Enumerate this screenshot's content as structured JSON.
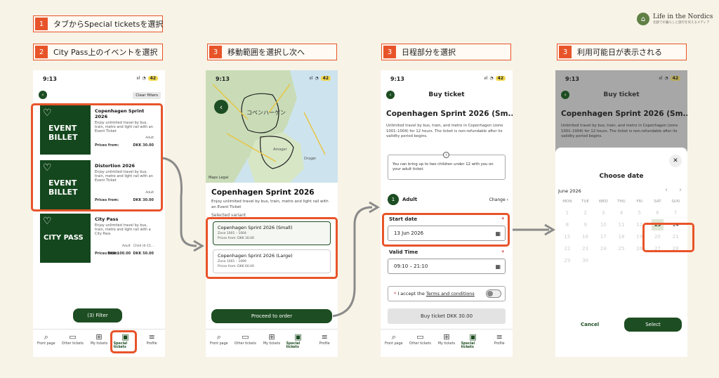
{
  "steps": [
    {
      "num": "1",
      "text": "タブからSpecial ticketsを選択"
    },
    {
      "num": "2",
      "text": "City Pass上のイベントを選択"
    },
    {
      "num": "3",
      "text": "移動範囲を選択し次へ"
    },
    {
      "num": "3",
      "text": "日程部分を選択"
    },
    {
      "num": "3",
      "text": "利用可能日が表示される"
    }
  ],
  "logo": {
    "title": "Life in the Nordics",
    "subtitle": "北欧での暮らしと旅行を伝えるメディア"
  },
  "status": {
    "time": "9:13",
    "signal": "ııl",
    "battery": "42"
  },
  "tabs": [
    "Front page",
    "Other tickets",
    "My tickets",
    "Special tickets",
    "Profile"
  ],
  "s1": {
    "clear": "Clear filters",
    "filter": "(3) Filter",
    "prices_from": "Prices from:",
    "adult": "Adult",
    "child": "Child (0-15...",
    "cards": [
      {
        "img": "EVENT\nBILLET",
        "title": "Copenhagen Sprint 2026",
        "desc": "Enjoy unlimited travel by bus, train, metro and light rail with an Event Ticket",
        "price": "DKK 30.00"
      },
      {
        "img": "EVENT\nBILLET",
        "title": "Distortion 2026",
        "desc": "Enjoy unlimited travel by bus, train, metro and light rail with an Event Ticket",
        "price": "DKK 30.00"
      },
      {
        "img": "CITY PASS",
        "title": "City Pass",
        "desc": "Enjoy unlimited travel by bus, train, metro and light rail with a City Pass",
        "price": "DKK 100.00",
        "price2": "DKK 50.00"
      }
    ]
  },
  "s2": {
    "map_city": "コペンハーゲン",
    "map_labels": [
      "Maps",
      "Legal",
      "Amager",
      "Dragør"
    ],
    "title": "Copenhagen Sprint 2026",
    "desc": "Enjoy unlimited travel by bus, train, metro and light rail with an Event Ticket",
    "selected_variant": "Selected variant",
    "variants": [
      {
        "title": "Copenhagen Sprint 2026 (Small)",
        "zone": "Zone 1001 – 1004",
        "price": "Prices from: DKK 30.00"
      },
      {
        "title": "Copenhagen Sprint 2026 (Large)",
        "zone": "Zone 1001 – 1099",
        "price": "Prices from: DKK 60.00"
      }
    ],
    "proceed": "Proceed to order"
  },
  "s3": {
    "header": "Buy ticket",
    "title": "Copenhagen Sprint 2026 (Sm...",
    "desc": "Unlimited travel by bus, train, and metro in Copenhagen (zone 1001–1004) for 12 hours. The ticket is non-refundable after its validity period begins.",
    "info": "You can bring up to two children under 12 with you on your adult ticket.",
    "adult_count": "1",
    "adult": "Adult",
    "change": "Change",
    "start_label": "Start date",
    "start_value": "13 Jun 2026",
    "valid_label": "Valid Time",
    "valid_value": "09:10 – 21:10",
    "accept_pre": "I accept the ",
    "terms": "Terms and conditions",
    "buy": "Buy ticket DKK 30.00"
  },
  "s4": {
    "header": "Buy ticket",
    "title": "Copenhagen Sprint 2026 (Sm...",
    "desc": "Unlimited travel by bus, train, and metro in Copenhagen (zone 1001–1004) for 12 hours. The ticket is non-refundable after its validity period begins.",
    "choose": "Choose date",
    "month": "June 2026",
    "weekdays": [
      "MON",
      "TUE",
      "WED",
      "THU",
      "FRI",
      "SAT",
      "SUN"
    ],
    "days": [
      "1",
      "2",
      "3",
      "4",
      "5",
      "6",
      "7",
      "8",
      "9",
      "10",
      "11",
      "12",
      "13",
      "14",
      "15",
      "16",
      "17",
      "18",
      "19",
      "20",
      "21",
      "22",
      "23",
      "24",
      "25",
      "26",
      "27",
      "28",
      "29",
      "30"
    ],
    "cancel": "Cancel",
    "select": "Select"
  }
}
